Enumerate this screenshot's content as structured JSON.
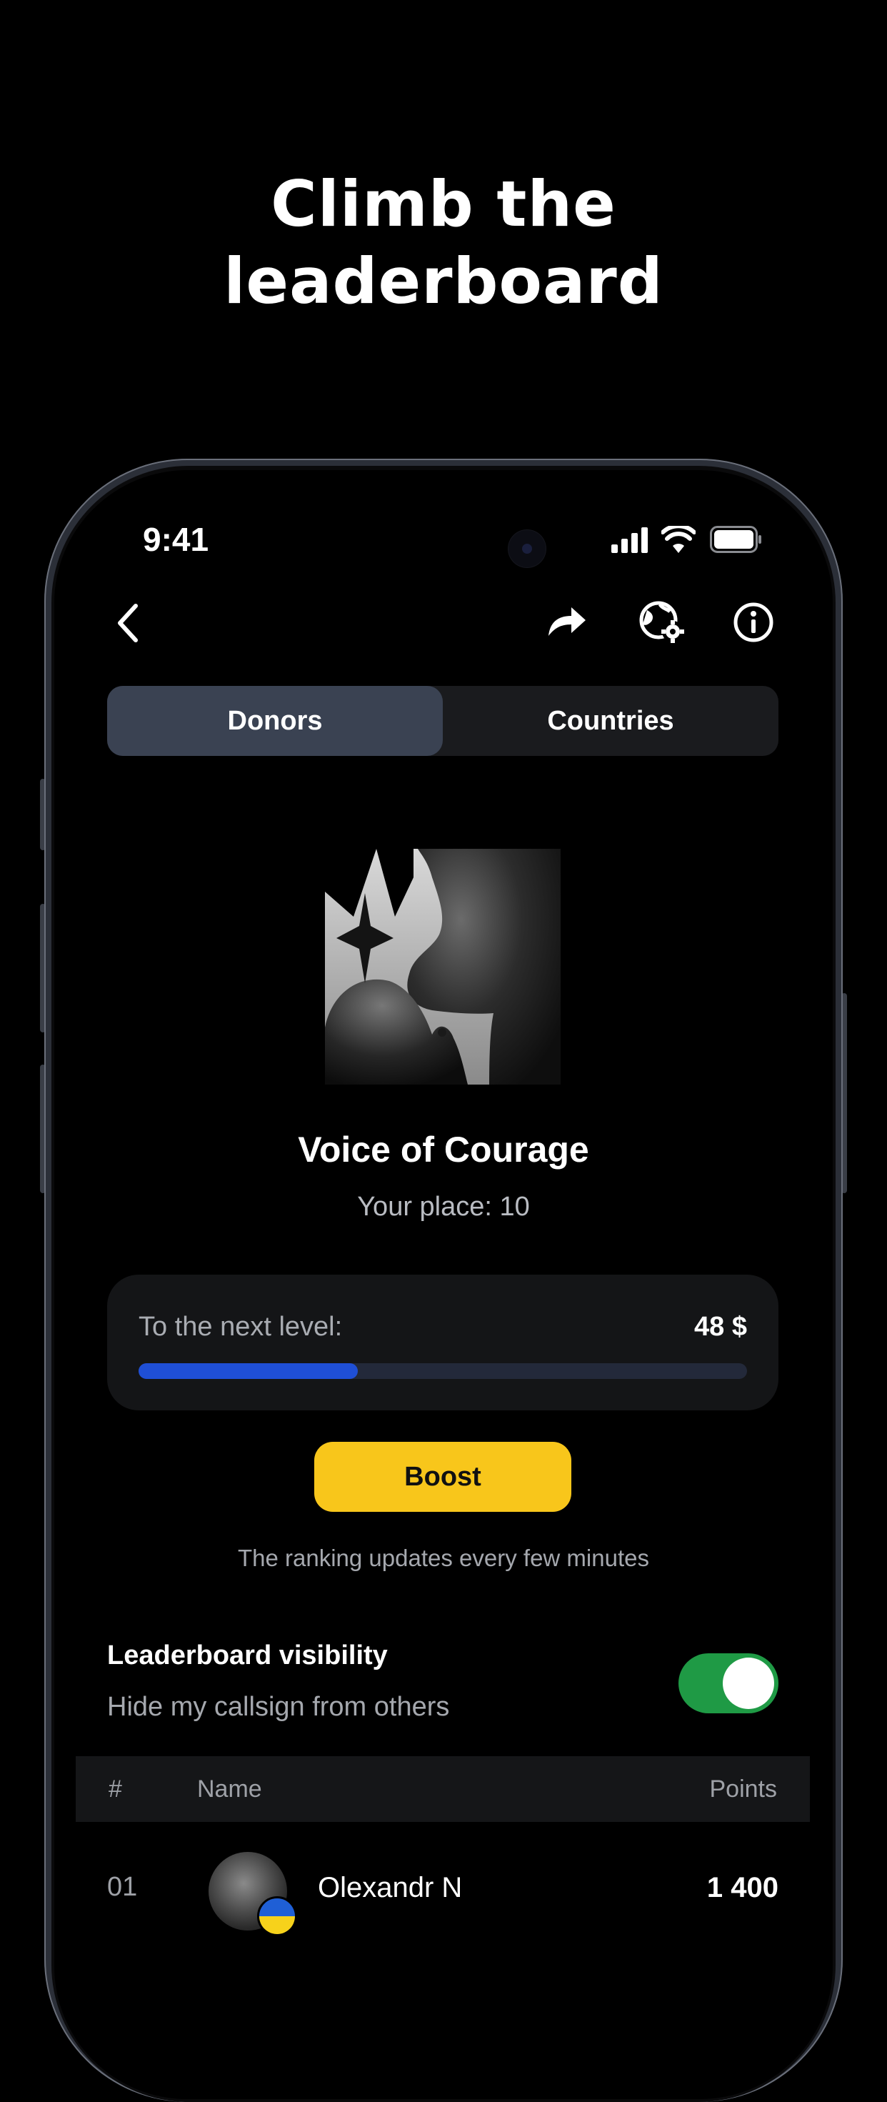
{
  "headline": {
    "line1": "Climb the",
    "line2": "leaderboard"
  },
  "status_bar": {
    "time": "9:41"
  },
  "tabs": [
    {
      "label": "Donors",
      "active": true
    },
    {
      "label": "Countries",
      "active": false
    }
  ],
  "level": {
    "title": "Voice of Courage",
    "place": "Your place: 10"
  },
  "progress": {
    "label": "To the next level:",
    "value": "48 $",
    "fraction": 0.36
  },
  "boost_label": "Boost",
  "ranking_note": "The ranking updates every few minutes",
  "visibility": {
    "title": "Leaderboard visibility",
    "subtitle": "Hide my callsign from others",
    "enabled": true
  },
  "table": {
    "headers": {
      "rank": "#",
      "name": "Name",
      "points": "Points"
    },
    "rows": [
      {
        "rank": "01",
        "name": "Olexandr N",
        "points": "1 400"
      }
    ]
  },
  "colors": {
    "accent_blue": "#1f4fd6",
    "boost_yellow": "#f8c61b",
    "toggle_green": "#1f9a45",
    "tab_active": "#3a4252"
  },
  "icons": [
    "back-chevron-icon",
    "share-arrow-icon",
    "globe-settings-icon",
    "info-icon",
    "signal-icon",
    "wifi-icon",
    "battery-icon"
  ]
}
